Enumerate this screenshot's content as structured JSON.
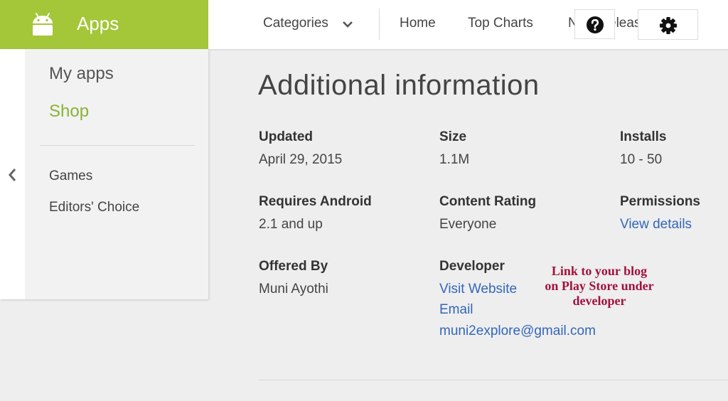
{
  "header": {
    "brand": "Apps",
    "nav": {
      "categories": "Categories",
      "home": "Home",
      "top_charts": "Top Charts",
      "new_releases": "New Releases"
    }
  },
  "sidebar": {
    "my_apps": "My apps",
    "shop": "Shop",
    "games": "Games",
    "editors_choice": "Editors' Choice"
  },
  "main": {
    "title": "Additional information",
    "updated": {
      "label": "Updated",
      "value": "April 29, 2015"
    },
    "size": {
      "label": "Size",
      "value": "1.1M"
    },
    "installs": {
      "label": "Installs",
      "value": "10 - 50"
    },
    "requires_android": {
      "label": "Requires Android",
      "value": "2.1 and up"
    },
    "content_rating": {
      "label": "Content Rating",
      "value": "Everyone"
    },
    "permissions": {
      "label": "Permissions",
      "link": "View details"
    },
    "offered_by": {
      "label": "Offered By",
      "value": "Muni Ayothi"
    },
    "developer": {
      "label": "Developer",
      "website": "Visit Website",
      "email_label": "Email",
      "email": "muni2explore@gmail.com"
    }
  },
  "annotation": {
    "line1": "Link to your blog",
    "line2": "on Play Store under",
    "line3": "developer"
  },
  "icons": {
    "brand": "android-icon",
    "categories": "chevron-down-icon",
    "help": "help-icon",
    "settings": "gear-icon",
    "sidebar": "chevron-left-icon"
  },
  "colors": {
    "brand": "#a4c639",
    "shop": "#8bb235",
    "link": "#3366bb",
    "annotation": "#a1123c"
  }
}
